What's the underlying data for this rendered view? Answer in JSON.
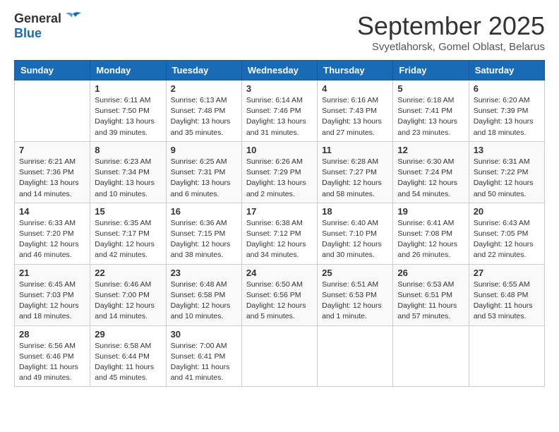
{
  "header": {
    "logo": {
      "general": "General",
      "blue": "Blue"
    },
    "title": "September 2025",
    "subtitle": "Svyetlahorsk, Gomel Oblast, Belarus"
  },
  "weekdays": [
    "Sunday",
    "Monday",
    "Tuesday",
    "Wednesday",
    "Thursday",
    "Friday",
    "Saturday"
  ],
  "weeks": [
    [
      {
        "day": "",
        "info": ""
      },
      {
        "day": "1",
        "info": "Sunrise: 6:11 AM\nSunset: 7:50 PM\nDaylight: 13 hours\nand 39 minutes."
      },
      {
        "day": "2",
        "info": "Sunrise: 6:13 AM\nSunset: 7:48 PM\nDaylight: 13 hours\nand 35 minutes."
      },
      {
        "day": "3",
        "info": "Sunrise: 6:14 AM\nSunset: 7:46 PM\nDaylight: 13 hours\nand 31 minutes."
      },
      {
        "day": "4",
        "info": "Sunrise: 6:16 AM\nSunset: 7:43 PM\nDaylight: 13 hours\nand 27 minutes."
      },
      {
        "day": "5",
        "info": "Sunrise: 6:18 AM\nSunset: 7:41 PM\nDaylight: 13 hours\nand 23 minutes."
      },
      {
        "day": "6",
        "info": "Sunrise: 6:20 AM\nSunset: 7:39 PM\nDaylight: 13 hours\nand 18 minutes."
      }
    ],
    [
      {
        "day": "7",
        "info": "Sunrise: 6:21 AM\nSunset: 7:36 PM\nDaylight: 13 hours\nand 14 minutes."
      },
      {
        "day": "8",
        "info": "Sunrise: 6:23 AM\nSunset: 7:34 PM\nDaylight: 13 hours\nand 10 minutes."
      },
      {
        "day": "9",
        "info": "Sunrise: 6:25 AM\nSunset: 7:31 PM\nDaylight: 13 hours\nand 6 minutes."
      },
      {
        "day": "10",
        "info": "Sunrise: 6:26 AM\nSunset: 7:29 PM\nDaylight: 13 hours\nand 2 minutes."
      },
      {
        "day": "11",
        "info": "Sunrise: 6:28 AM\nSunset: 7:27 PM\nDaylight: 12 hours\nand 58 minutes."
      },
      {
        "day": "12",
        "info": "Sunrise: 6:30 AM\nSunset: 7:24 PM\nDaylight: 12 hours\nand 54 minutes."
      },
      {
        "day": "13",
        "info": "Sunrise: 6:31 AM\nSunset: 7:22 PM\nDaylight: 12 hours\nand 50 minutes."
      }
    ],
    [
      {
        "day": "14",
        "info": "Sunrise: 6:33 AM\nSunset: 7:20 PM\nDaylight: 12 hours\nand 46 minutes."
      },
      {
        "day": "15",
        "info": "Sunrise: 6:35 AM\nSunset: 7:17 PM\nDaylight: 12 hours\nand 42 minutes."
      },
      {
        "day": "16",
        "info": "Sunrise: 6:36 AM\nSunset: 7:15 PM\nDaylight: 12 hours\nand 38 minutes."
      },
      {
        "day": "17",
        "info": "Sunrise: 6:38 AM\nSunset: 7:12 PM\nDaylight: 12 hours\nand 34 minutes."
      },
      {
        "day": "18",
        "info": "Sunrise: 6:40 AM\nSunset: 7:10 PM\nDaylight: 12 hours\nand 30 minutes."
      },
      {
        "day": "19",
        "info": "Sunrise: 6:41 AM\nSunset: 7:08 PM\nDaylight: 12 hours\nand 26 minutes."
      },
      {
        "day": "20",
        "info": "Sunrise: 6:43 AM\nSunset: 7:05 PM\nDaylight: 12 hours\nand 22 minutes."
      }
    ],
    [
      {
        "day": "21",
        "info": "Sunrise: 6:45 AM\nSunset: 7:03 PM\nDaylight: 12 hours\nand 18 minutes."
      },
      {
        "day": "22",
        "info": "Sunrise: 6:46 AM\nSunset: 7:00 PM\nDaylight: 12 hours\nand 14 minutes."
      },
      {
        "day": "23",
        "info": "Sunrise: 6:48 AM\nSunset: 6:58 PM\nDaylight: 12 hours\nand 10 minutes."
      },
      {
        "day": "24",
        "info": "Sunrise: 6:50 AM\nSunset: 6:56 PM\nDaylight: 12 hours\nand 5 minutes."
      },
      {
        "day": "25",
        "info": "Sunrise: 6:51 AM\nSunset: 6:53 PM\nDaylight: 12 hours\nand 1 minute."
      },
      {
        "day": "26",
        "info": "Sunrise: 6:53 AM\nSunset: 6:51 PM\nDaylight: 11 hours\nand 57 minutes."
      },
      {
        "day": "27",
        "info": "Sunrise: 6:55 AM\nSunset: 6:48 PM\nDaylight: 11 hours\nand 53 minutes."
      }
    ],
    [
      {
        "day": "28",
        "info": "Sunrise: 6:56 AM\nSunset: 6:46 PM\nDaylight: 11 hours\nand 49 minutes."
      },
      {
        "day": "29",
        "info": "Sunrise: 6:58 AM\nSunset: 6:44 PM\nDaylight: 11 hours\nand 45 minutes."
      },
      {
        "day": "30",
        "info": "Sunrise: 7:00 AM\nSunset: 6:41 PM\nDaylight: 11 hours\nand 41 minutes."
      },
      {
        "day": "",
        "info": ""
      },
      {
        "day": "",
        "info": ""
      },
      {
        "day": "",
        "info": ""
      },
      {
        "day": "",
        "info": ""
      }
    ]
  ]
}
